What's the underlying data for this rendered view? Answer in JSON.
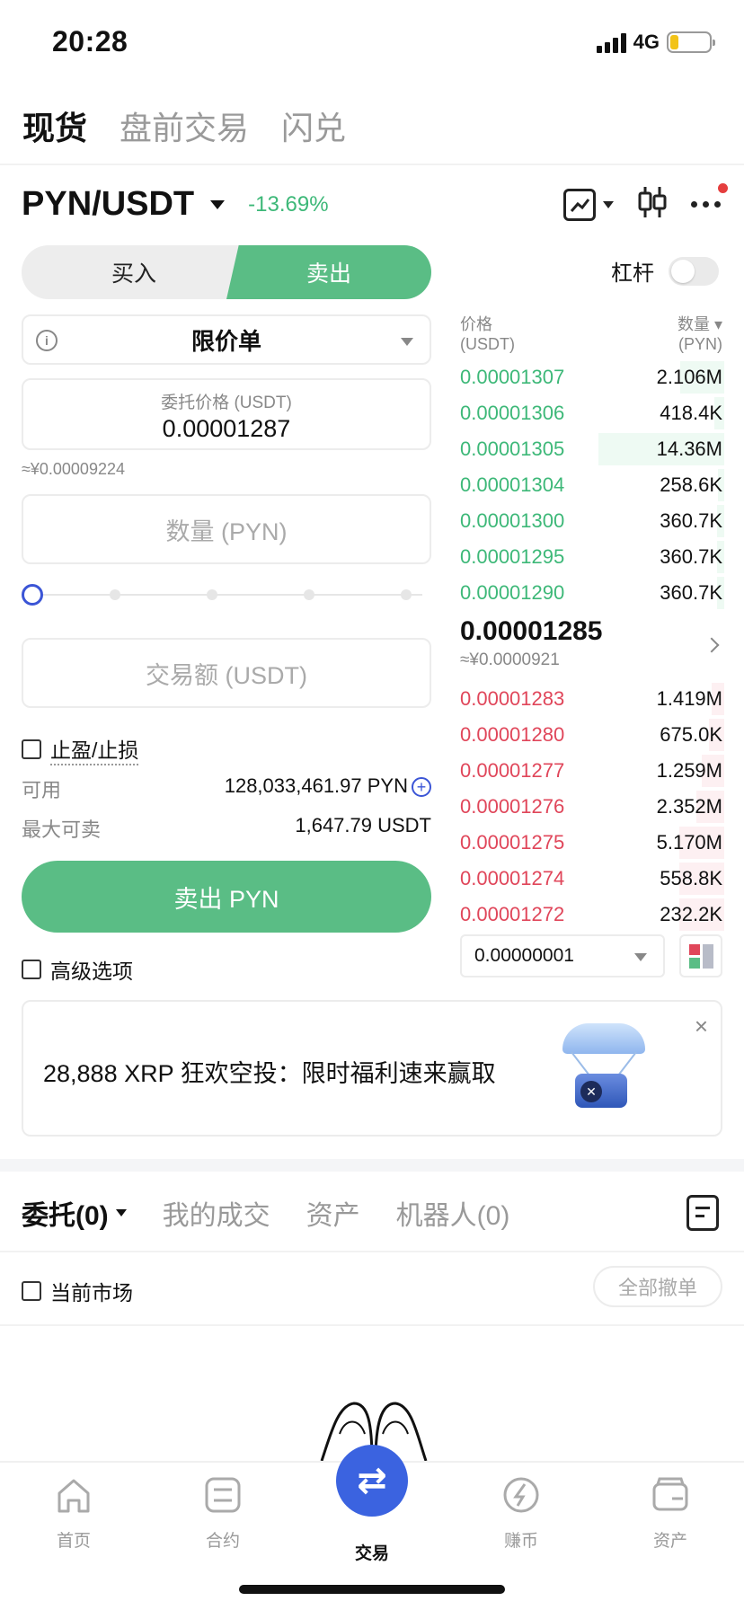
{
  "status_bar": {
    "time": "20:28",
    "network": "4G"
  },
  "top_tabs": [
    {
      "label": "现货",
      "active": true
    },
    {
      "label": "盘前交易",
      "active": false
    },
    {
      "label": "闪兑",
      "active": false
    }
  ],
  "pair": {
    "name": "PYN/USDT",
    "change": "-13.69%",
    "change_color": "#3db878"
  },
  "side_toggle": {
    "buy_label": "买入",
    "sell_label": "卖出",
    "selected": "sell"
  },
  "leverage": {
    "label": "杠杆",
    "enabled": false
  },
  "order_form": {
    "order_type": "限价单",
    "price_label": "委托价格 (USDT)",
    "price_value": "0.00001287",
    "price_approx": "≈¥0.00009224",
    "qty_placeholder": "数量 (PYN)",
    "amount_placeholder": "交易额 (USDT)",
    "slider_percent": 0,
    "tpsl_label": "止盈/止损",
    "available_label": "可用",
    "available_value": "128,033,461.97 PYN",
    "max_sell_label": "最大可卖",
    "max_sell_value": "1,647.79 USDT",
    "submit_label": "卖出 PYN",
    "advanced_label": "高级选项"
  },
  "order_book": {
    "price_header": "价格",
    "price_unit": "(USDT)",
    "qty_header": "数量 ▾",
    "qty_unit": "(PYN)",
    "asks": [
      {
        "price": "0.00001307",
        "qty": "2.106M",
        "depth": 0.35
      },
      {
        "price": "0.00001306",
        "qty": "418.4K",
        "depth": 0.08
      },
      {
        "price": "0.00001305",
        "qty": "14.36M",
        "depth": 1.0
      },
      {
        "price": "0.00001304",
        "qty": "258.6K",
        "depth": 0.05
      },
      {
        "price": "0.00001300",
        "qty": "360.7K",
        "depth": 0.06
      },
      {
        "price": "0.00001295",
        "qty": "360.7K",
        "depth": 0.06
      },
      {
        "price": "0.00001290",
        "qty": "360.7K",
        "depth": 0.06
      }
    ],
    "last_price": "0.00001285",
    "last_price_approx": "≈¥0.0000921",
    "bids": [
      {
        "price": "0.00001283",
        "qty": "1.419M",
        "depth": 0.1
      },
      {
        "price": "0.00001280",
        "qty": "675.0K",
        "depth": 0.12
      },
      {
        "price": "0.00001277",
        "qty": "1.259M",
        "depth": 0.18
      },
      {
        "price": "0.00001276",
        "qty": "2.352M",
        "depth": 0.22
      },
      {
        "price": "0.00001275",
        "qty": "5.170M",
        "depth": 0.36
      },
      {
        "price": "0.00001274",
        "qty": "558.8K",
        "depth": 0.36
      },
      {
        "price": "0.00001272",
        "qty": "232.2K",
        "depth": 0.36
      }
    ],
    "precision": "0.00000001"
  },
  "banner": {
    "text": "28,888 XRP 狂欢空投：限时福利速来赢取",
    "close": "×"
  },
  "orders_tabs": [
    {
      "label": "委托(0)",
      "active": true
    },
    {
      "label": "我的成交",
      "active": false
    },
    {
      "label": "资产",
      "active": false
    },
    {
      "label": "机器人(0)",
      "active": false
    }
  ],
  "current_market_label": "当前市场",
  "cancel_all_label": "全部撤单",
  "bottom_nav": [
    {
      "label": "首页",
      "icon": "home-icon"
    },
    {
      "label": "合约",
      "icon": "contract-icon"
    },
    {
      "label": "交易",
      "icon": "trade-icon",
      "active": true
    },
    {
      "label": "赚币",
      "icon": "earn-icon"
    },
    {
      "label": "资产",
      "icon": "wallet-icon"
    }
  ]
}
